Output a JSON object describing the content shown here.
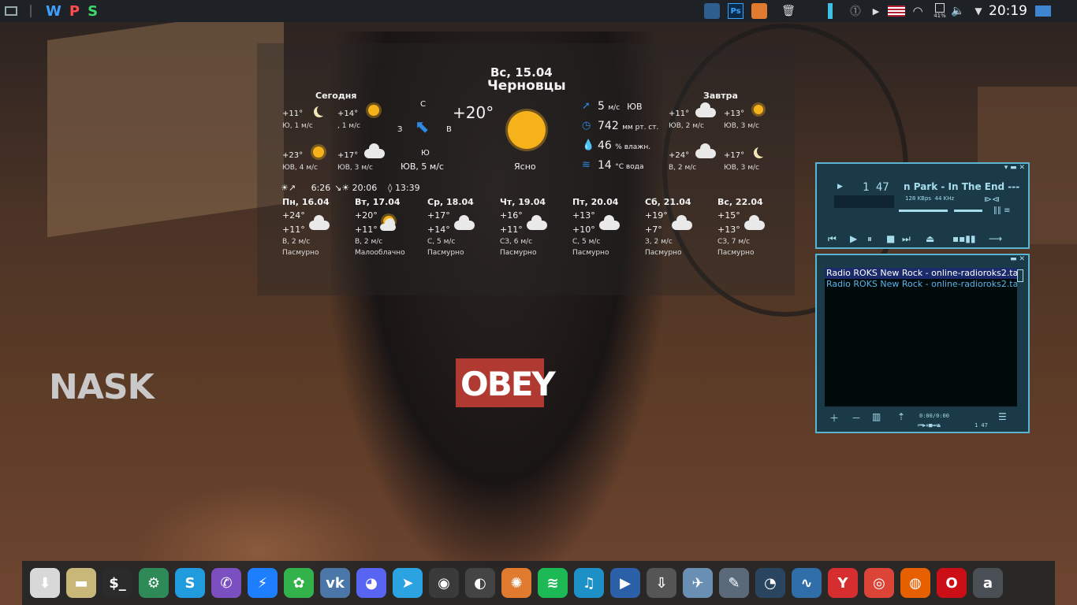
{
  "topbar": {
    "wps": {
      "w": "W",
      "p": "P",
      "s": "S"
    },
    "ps_label": "Ps",
    "battery_percent": "41%",
    "clock": "20:19"
  },
  "weather": {
    "date": "Вс, 15.04",
    "city": "Черновцы",
    "today_label": "Сегодня",
    "tomorrow_label": "Завтра",
    "current_temp": "+20°",
    "condition": "Ясно",
    "wind_current": "ЮВ, 5 м/с",
    "compass": {
      "n": "С",
      "s": "Ю",
      "w": "З",
      "e": "В"
    },
    "today_periods": [
      {
        "temp": "+11°",
        "wind": "Ю, 1 м/с",
        "icon": "moon-icon"
      },
      {
        "temp": "+14°",
        "wind": ", 1 м/с",
        "icon": "sun-icon"
      },
      {
        "temp": "+23°",
        "wind": "ЮВ, 4 м/с",
        "icon": "sun-icon"
      },
      {
        "temp": "+17°",
        "wind": "ЮВ, 3 м/с",
        "icon": "cloud-icon"
      }
    ],
    "tomorrow_periods": [
      {
        "temp": "+11°",
        "wind": "ЮВ, 2 м/с",
        "icon": "cloud-icon"
      },
      {
        "temp": "+13°",
        "wind": "ЮВ, 3 м/с",
        "icon": "partly-cloudy-icon"
      },
      {
        "temp": "+24°",
        "wind": "В, 2 м/с",
        "icon": "cloud-icon"
      },
      {
        "temp": "+17°",
        "wind": "ЮВ, 3 м/с",
        "icon": "moon-icon"
      }
    ],
    "details": {
      "wind_value": "5",
      "wind_unit": "м/с",
      "wind_dir": "ЮВ",
      "pressure_value": "742",
      "pressure_unit": "мм рт. ст.",
      "humidity_value": "46",
      "humidity_unit": "% влажн.",
      "water_value": "14",
      "water_unit": "°С вода"
    },
    "sunrise": "6:26",
    "sunset": "20:06",
    "day_length": "13:39",
    "forecast": [
      {
        "day": "Пн, 16.04",
        "hi": "+24°",
        "lo": "+11°",
        "wind": "В, 2 м/с",
        "desc": "Пасмурно",
        "icon": "cloud-icon"
      },
      {
        "day": "Вт, 17.04",
        "hi": "+20°",
        "lo": "+11°",
        "wind": "В, 2 м/с",
        "desc": "Малооблачно",
        "icon": "partly-cloudy-icon"
      },
      {
        "day": "Ср, 18.04",
        "hi": "+17°",
        "lo": "+14°",
        "wind": "С, 5 м/с",
        "desc": "Пасмурно",
        "icon": "cloud-icon"
      },
      {
        "day": "Чт, 19.04",
        "hi": "+16°",
        "lo": "+11°",
        "wind": "СЗ, 6 м/с",
        "desc": "Пасмурно",
        "icon": "cloud-icon"
      },
      {
        "day": "Пт, 20.04",
        "hi": "+13°",
        "lo": "+10°",
        "wind": "С, 5 м/с",
        "desc": "Пасмурно",
        "icon": "cloud-icon"
      },
      {
        "day": "Сб, 21.04",
        "hi": "+19°",
        "lo": "+7°",
        "wind": "З, 2 м/с",
        "desc": "Пасмурно",
        "icon": "cloud-icon"
      },
      {
        "day": "Вс, 22.04",
        "hi": "+15°",
        "lo": "+13°",
        "wind": "СЗ, 7 м/с",
        "desc": "Пасмурно",
        "icon": "cloud-icon"
      }
    ]
  },
  "player": {
    "time": "1 47",
    "title": "n Park - In The End ---",
    "bitrate": "128 KBps",
    "samplerate": "44 KHz"
  },
  "playlist": {
    "items": [
      {
        "text": "Radio ROKS New Rock - online-radioroks2.tav",
        "selected": true
      },
      {
        "text": "Radio ROKS New Rock - online-radioroks2.tav",
        "selected": false
      }
    ],
    "footer_time": "0:00/0:00",
    "footer_total": "1 47"
  },
  "desktop": {
    "brand": "NASK",
    "shirt_text": "OBEY"
  },
  "dock": {
    "items": [
      {
        "name": "software-center-icon",
        "glyph": "⬇",
        "color": "#d8d8d8"
      },
      {
        "name": "files-icon",
        "glyph": "▬",
        "color": "#c9b77a"
      },
      {
        "name": "terminal-icon",
        "glyph": "$_",
        "color": "#2b2b2b"
      },
      {
        "name": "settings-icon",
        "glyph": "⚙",
        "color": "#2e8b57"
      },
      {
        "name": "skype-icon",
        "glyph": "S",
        "color": "#1f9bde"
      },
      {
        "name": "viber-icon",
        "glyph": "✆",
        "color": "#7b4fbf"
      },
      {
        "name": "messenger-icon",
        "glyph": "⚡",
        "color": "#1d7fff"
      },
      {
        "name": "icq-icon",
        "glyph": "✿",
        "color": "#32b24a"
      },
      {
        "name": "vk-icon",
        "glyph": "vk",
        "color": "#4a76a8"
      },
      {
        "name": "discord-icon",
        "glyph": "◕",
        "color": "#5865f2"
      },
      {
        "name": "telegram-icon",
        "glyph": "➤",
        "color": "#2aa3e0"
      },
      {
        "name": "obs-icon",
        "glyph": "◉",
        "color": "#3a3a3a"
      },
      {
        "name": "palette-icon",
        "glyph": "◐",
        "color": "#444"
      },
      {
        "name": "photos-icon",
        "glyph": "✺",
        "color": "#e07a2f"
      },
      {
        "name": "spotify-icon",
        "glyph": "≋",
        "color": "#1db954"
      },
      {
        "name": "audio-icon",
        "glyph": "♫",
        "color": "#1e90c8"
      },
      {
        "name": "video-editor-icon",
        "glyph": "▶",
        "color": "#2b5fa8"
      },
      {
        "name": "downloader-icon",
        "glyph": "⇩",
        "color": "#555"
      },
      {
        "name": "wine-icon",
        "glyph": "✈",
        "color": "#6a8fb5"
      },
      {
        "name": "pen-icon",
        "glyph": "✎",
        "color": "#5a6a7a"
      },
      {
        "name": "speedometer-icon",
        "glyph": "◔",
        "color": "#2a4560"
      },
      {
        "name": "waveform-icon",
        "glyph": "∿",
        "color": "#2f6ea8"
      },
      {
        "name": "yandex-browser-icon",
        "glyph": "Y",
        "color": "#d62e2e"
      },
      {
        "name": "chrome-icon",
        "glyph": "◎",
        "color": "#db4437"
      },
      {
        "name": "firefox-icon",
        "glyph": "◍",
        "color": "#e66000"
      },
      {
        "name": "opera-icon",
        "glyph": "O",
        "color": "#cc0f16"
      },
      {
        "name": "app-launcher-icon",
        "glyph": "a",
        "color": "#4a4f55"
      }
    ]
  }
}
